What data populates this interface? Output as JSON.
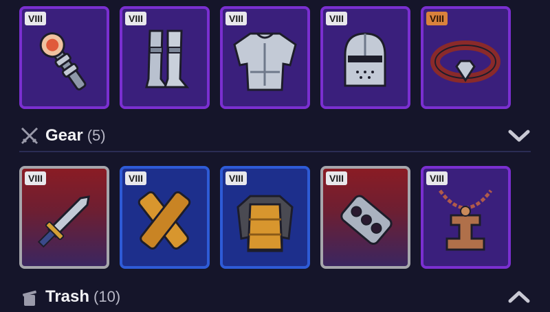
{
  "top_row": [
    {
      "tier": "VIII",
      "item": "mace-icon",
      "frame": "purple",
      "badge": "light"
    },
    {
      "tier": "VIII",
      "item": "greaves-icon",
      "frame": "purple",
      "badge": "light"
    },
    {
      "tier": "VIII",
      "item": "chest-armor-icon",
      "frame": "purple",
      "badge": "light"
    },
    {
      "tier": "VIII",
      "item": "helmet-icon",
      "frame": "purple",
      "badge": "light"
    },
    {
      "tier": "VIII",
      "item": "belt-icon",
      "frame": "purple",
      "badge": "orange"
    }
  ],
  "gear_section": {
    "title": "Gear",
    "count": "(5)",
    "icon": "crossed-swords-icon",
    "toggle": "chevron-down-icon"
  },
  "bottom_row": [
    {
      "tier": "VIII",
      "item": "dagger-icon",
      "frame": "gray",
      "badge": "light"
    },
    {
      "tier": "VIII",
      "item": "bracers-icon",
      "frame": "blue",
      "badge": "light"
    },
    {
      "tier": "VIII",
      "item": "leather-armor-icon",
      "frame": "blue",
      "badge": "light"
    },
    {
      "tier": "VIII",
      "item": "knuckles-icon",
      "frame": "gray",
      "badge": "light"
    },
    {
      "tier": "VIII",
      "item": "amulet-icon",
      "frame": "purple",
      "badge": "light"
    }
  ],
  "trash_section": {
    "title": "Trash",
    "count": "(10)",
    "icon": "trash-can-icon",
    "toggle": "chevron-up-icon"
  },
  "colors": {
    "background": "#15152a",
    "purple_frame": "#7a2fd0",
    "blue_frame": "#2e5bd6",
    "gray_frame": "#a6a6ac",
    "orange_badge": "#d9823c"
  }
}
